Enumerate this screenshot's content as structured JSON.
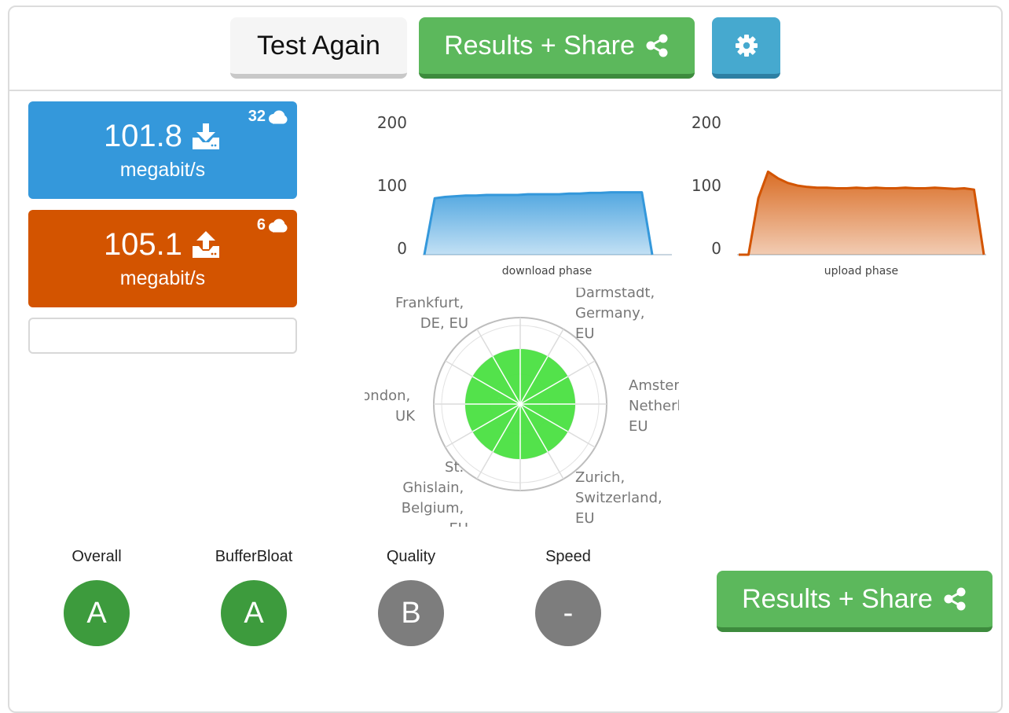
{
  "toolbar": {
    "test_again_label": "Test Again",
    "results_share_label": "Results + Share"
  },
  "download": {
    "value": "101.8",
    "unit": "megabit/s",
    "servers": "32",
    "color": "#3498db"
  },
  "upload": {
    "value": "105.1",
    "unit": "megabit/s",
    "servers": "6",
    "color": "#d35400"
  },
  "chart_data": [
    {
      "type": "area",
      "xlabel": "download phase",
      "ylim": [
        0,
        200
      ],
      "yticks": [
        "200",
        "100",
        "0"
      ],
      "values": [
        0,
        85,
        87,
        88,
        89,
        89,
        90,
        90,
        90,
        90,
        91,
        91,
        91,
        91,
        92,
        92,
        93,
        93,
        94,
        94,
        94,
        94,
        0
      ],
      "color": "#3498db"
    },
    {
      "type": "area",
      "xlabel": "upload phase",
      "ylim": [
        0,
        200
      ],
      "yticks": [
        "200",
        "100",
        "0"
      ],
      "values": [
        0,
        0,
        85,
        125,
        115,
        108,
        104,
        102,
        101,
        101,
        100,
        100,
        101,
        100,
        101,
        100,
        100,
        101,
        100,
        100,
        101,
        100,
        99,
        100,
        98,
        0
      ],
      "color": "#d35400"
    }
  ],
  "radar": {
    "locations": {
      "frankfurt": [
        "Frankfurt,",
        "DE, EU"
      ],
      "darmstadt": [
        "Darmstadt,",
        "Germany,",
        "EU"
      ],
      "amsterdam": [
        "Amsterdam,",
        "Netherlands,",
        "EU"
      ],
      "zurich": [
        "Zurich,",
        "Switzerland,",
        "EU"
      ],
      "ghislain": [
        "St.",
        "Ghislain,",
        "Belgium,",
        "EU"
      ],
      "london": [
        "London,",
        "UK"
      ]
    },
    "fill_color": "#44e03c"
  },
  "grades": [
    {
      "label": "Overall",
      "grade": "A",
      "color": "#3d9b3d"
    },
    {
      "label": "BufferBloat",
      "grade": "A",
      "color": "#3d9b3d"
    },
    {
      "label": "Quality",
      "grade": "B",
      "color": "#7d7d7d"
    },
    {
      "label": "Speed",
      "grade": "-",
      "color": "#7d7d7d"
    }
  ]
}
